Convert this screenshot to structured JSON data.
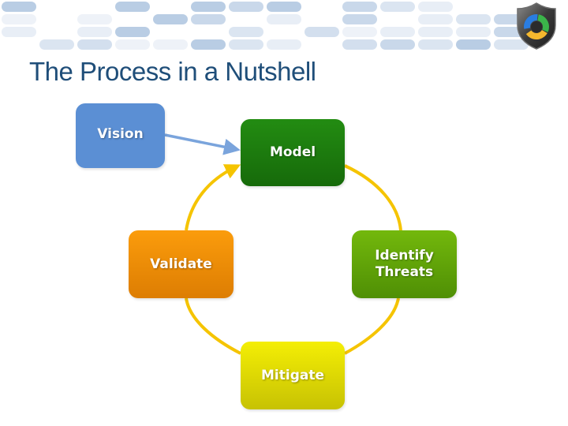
{
  "slide": {
    "title": "The Process in a Nutshell",
    "logo_icon": "shield-cycle-icon"
  },
  "diagram": {
    "nodes": [
      {
        "id": "vision",
        "label": "Vision",
        "color": "#5b8fd4"
      },
      {
        "id": "model",
        "label": "Model",
        "color": "#1c7c0e"
      },
      {
        "id": "identify",
        "label": "Identify Threats",
        "line1": "Identify",
        "line2": "Threats",
        "color": "#66a60a"
      },
      {
        "id": "mitigate",
        "label": "Mitigate",
        "color": "#e0da04"
      },
      {
        "id": "validate",
        "label": "Validate",
        "color": "#f08f08"
      }
    ],
    "edges": [
      {
        "from": "vision",
        "to": "model",
        "color": "#7aa4dc"
      },
      {
        "from": "model",
        "to": "identify",
        "color": "#f5c400"
      },
      {
        "from": "identify",
        "to": "mitigate",
        "color": "#f5c400"
      },
      {
        "from": "mitigate",
        "to": "validate",
        "color": "#f5c400"
      },
      {
        "from": "validate",
        "to": "model",
        "color": "#f5c400"
      }
    ]
  }
}
